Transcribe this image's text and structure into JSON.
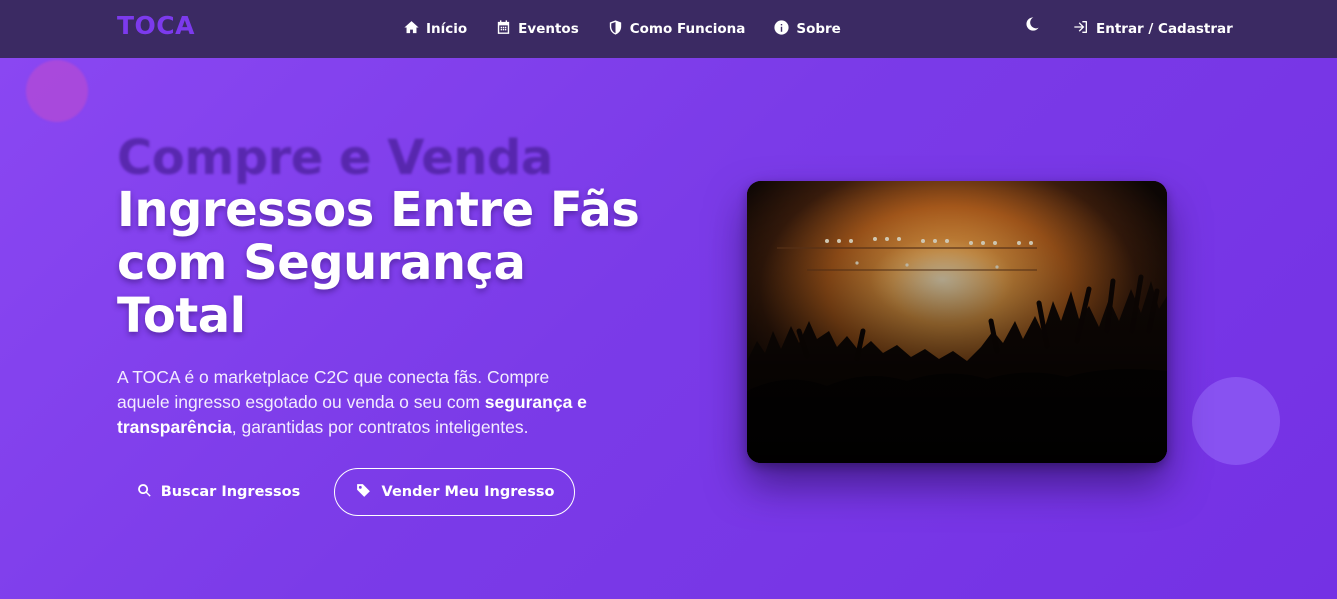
{
  "brand": "TOCA",
  "nav": {
    "items": [
      {
        "label": "Início",
        "icon": "home-icon"
      },
      {
        "label": "Eventos",
        "icon": "calendar-icon"
      },
      {
        "label": "Como Funciona",
        "icon": "shield-icon"
      },
      {
        "label": "Sobre",
        "icon": "info-icon"
      }
    ],
    "theme_icon": "moon-icon",
    "login_label": "Entrar / Cadastrar"
  },
  "hero": {
    "headline_faded": "Compre e Venda",
    "headline_line1": "Ingressos Entre Fãs",
    "headline_line2": "com Segurança",
    "headline_line3": "Total",
    "lead_part1": "A TOCA é o marketplace C2C que conecta fãs. Compre aquele ingresso esgotado ou venda o seu com ",
    "lead_bold": "segurança e transparência",
    "lead_part2": ", garantidas por contratos inteligentes.",
    "search_button": "Buscar Ingressos",
    "sell_button": "Vender Meu Ingresso",
    "image_alt": "concert-crowd-image"
  },
  "colors": {
    "navbar": "#3b2a63",
    "brand": "#7c3aed",
    "hero_bg": "#7b3be8",
    "text": "#ffffff"
  }
}
